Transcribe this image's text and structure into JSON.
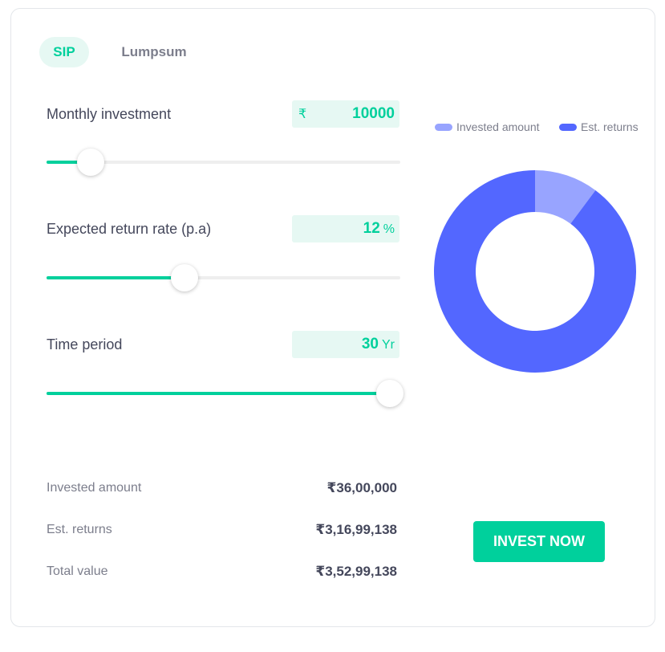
{
  "tabs": [
    {
      "label": "SIP",
      "active": true
    },
    {
      "label": "Lumpsum",
      "active": false
    }
  ],
  "inputs": {
    "monthly": {
      "label": "Monthly investment",
      "prefix": "₹",
      "value": "10000",
      "unit": "",
      "slider_fraction": 0.125
    },
    "rate": {
      "label": "Expected return rate (p.a)",
      "prefix": "",
      "value": "12",
      "unit": "%",
      "slider_fraction": 0.389
    },
    "period": {
      "label": "Time period",
      "prefix": "",
      "value": "30",
      "unit": "Yr",
      "slider_fraction": 0.97
    }
  },
  "summary": {
    "invested": {
      "label": "Invested amount",
      "value": "₹36,00,000"
    },
    "returns": {
      "label": "Est. returns",
      "value": "₹3,16,99,138"
    },
    "total": {
      "label": "Total value",
      "value": "₹3,52,99,138"
    }
  },
  "chart_data": {
    "type": "pie",
    "donut": true,
    "series": [
      {
        "name": "Invested amount",
        "value": 3600000,
        "color": "#98a4ff"
      },
      {
        "name": "Est. returns",
        "value": 31699138,
        "color": "#5367ff"
      }
    ],
    "legend_position": "top"
  },
  "cta": {
    "label": "INVEST NOW"
  },
  "colors": {
    "accent": "#00d09c",
    "invested": "#98a4ff",
    "returns": "#5367ff"
  }
}
